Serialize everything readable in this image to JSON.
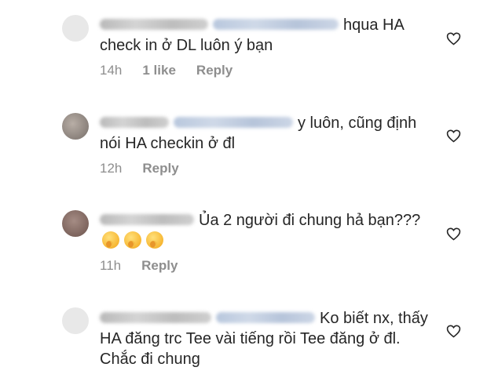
{
  "comments": [
    {
      "text": "hqua HA check in ở DL luôn ý bạn",
      "time": "14h",
      "likes": "1 like",
      "reply": "Reply",
      "avatar_color": "#e6e6e6"
    },
    {
      "text": "y luôn, cũng định nói HA checkin ở đl",
      "time": "12h",
      "reply": "Reply",
      "avatar_color": "#9d958f"
    },
    {
      "text": "Ủa 2 người đi chung hả bạn???",
      "time": "11h",
      "reply": "Reply",
      "avatar_color": "#8f7770",
      "emoji": [
        "thinking-face",
        "thinking-face",
        "thinking-face"
      ]
    },
    {
      "text": "Ko biết nx, thấy HA đăng trc Tee vài tiếng rồi Tee đăng ở đl. Chắc đi chung",
      "time": "",
      "reply": "",
      "avatar_color": "#e6e6e6"
    }
  ],
  "icons": {
    "heart": "heart-outline-icon"
  },
  "colors": {
    "text": "#262626",
    "meta": "#8e8e8e",
    "username_blur": "#c4c4c4",
    "mention_blur": "#c3cfe1"
  }
}
